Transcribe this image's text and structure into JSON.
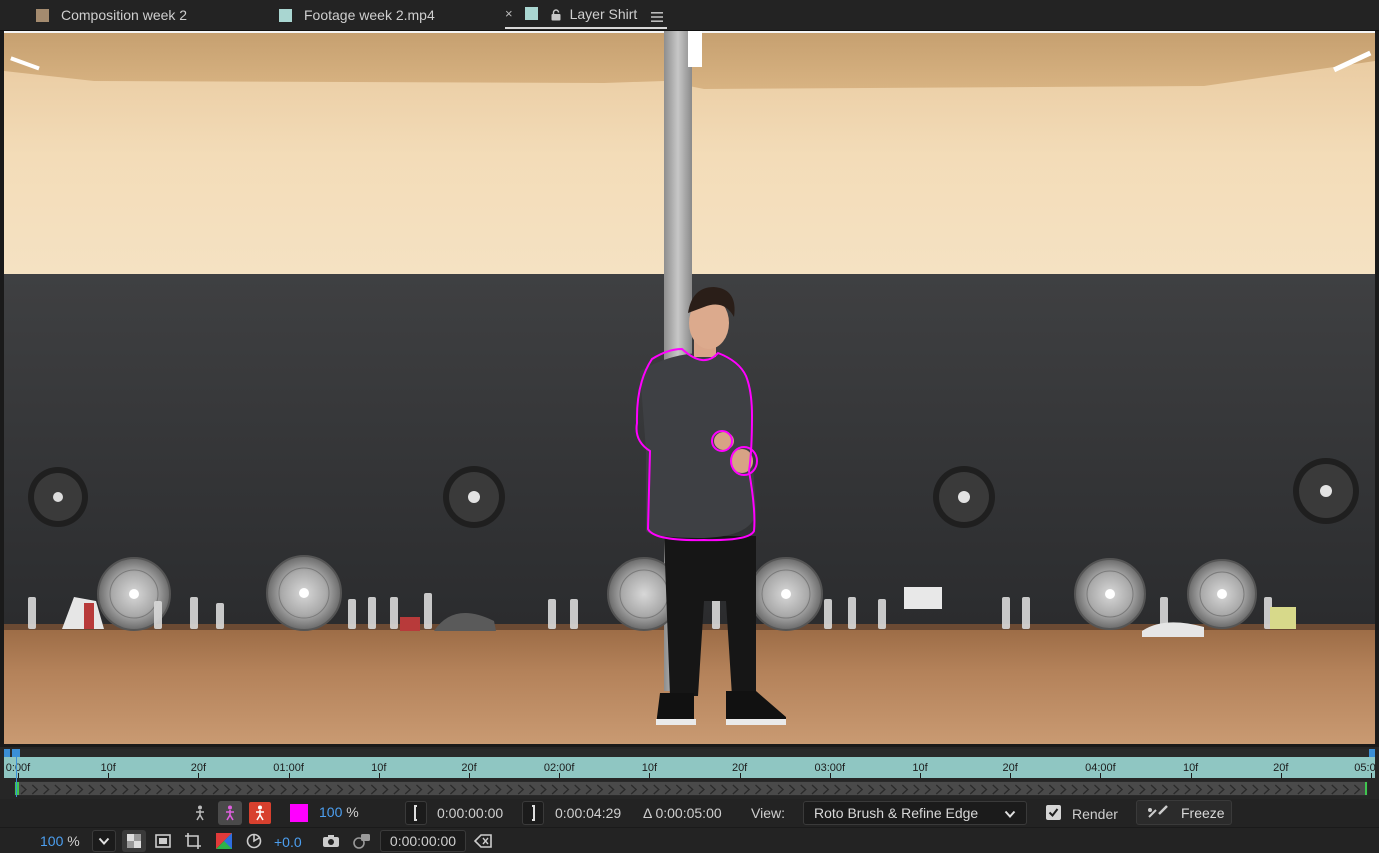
{
  "tabs": [
    {
      "label": "Composition week 2",
      "swatch": "#a48b6f"
    },
    {
      "label": "Footage week 2.mp4",
      "swatch": "#a9d6d1"
    },
    {
      "label": "Layer Shirt",
      "swatch": "#a9d6d1",
      "close": "×",
      "active": true
    }
  ],
  "timeline": {
    "labels": [
      "0:00f",
      "10f",
      "20f",
      "01:00f",
      "10f",
      "20f",
      "02:00f",
      "10f",
      "20f",
      "03:00f",
      "10f",
      "20f",
      "04:00f",
      "10f",
      "20f",
      "05:0"
    ],
    "ruler_color": "#8fc6c2",
    "playhead_color": "#3b8fd6"
  },
  "controls": {
    "roto_color": "#ff00ff",
    "overlay_opacity": "100",
    "overlay_unit": "%",
    "start_time": "0:00:00:00",
    "end_time": "0:00:04:29",
    "duration": "Δ 0:00:05:00",
    "view_label": "View:",
    "view_value": "Roto Brush & Refine Edge",
    "render_label": "Render",
    "render_checked": true,
    "freeze_label": "Freeze"
  },
  "bottom": {
    "zoom": "100",
    "zoom_unit": "%",
    "exposure": "+0.0",
    "timecode": "0:00:00:00"
  },
  "icons": {
    "tab_lock": "lock-icon",
    "tab_menu": "hamburger-menu-icon",
    "brush": "roto-brush-icon"
  }
}
